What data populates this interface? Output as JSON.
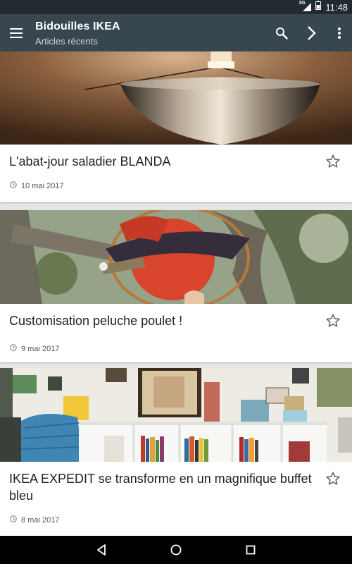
{
  "status_bar": {
    "network_type": "3G",
    "time": "11:48"
  },
  "app_bar": {
    "title": "Bidouilles IKEA",
    "subtitle": "Articles récents",
    "icons": [
      "menu-icon",
      "search-icon",
      "chevron-right-icon",
      "more-vert-icon"
    ]
  },
  "articles": [
    {
      "title": "L'abat-jour saladier BLANDA",
      "date": "10 mai 2017",
      "image": "brass bowl lamp shade on warm background",
      "starred": false
    },
    {
      "title": "Customisation peluche poulet !",
      "date": "9 mai 2017",
      "image": "red plush chicken in a tree",
      "starred": false
    },
    {
      "title": "IKEA EXPEDIT se transforme en un magnifique buffet bleu",
      "date": "8 mai 2017",
      "image": "living room with white bookshelf and blue chair",
      "starred": false
    }
  ],
  "colors": {
    "status_bar": "#202a30",
    "app_bar": "#37464f",
    "background": "#e6e6e6",
    "card": "#ffffff",
    "nav_bar": "#000000"
  },
  "nav_bar": {
    "icons": [
      "back-icon",
      "home-icon",
      "recents-icon"
    ]
  }
}
